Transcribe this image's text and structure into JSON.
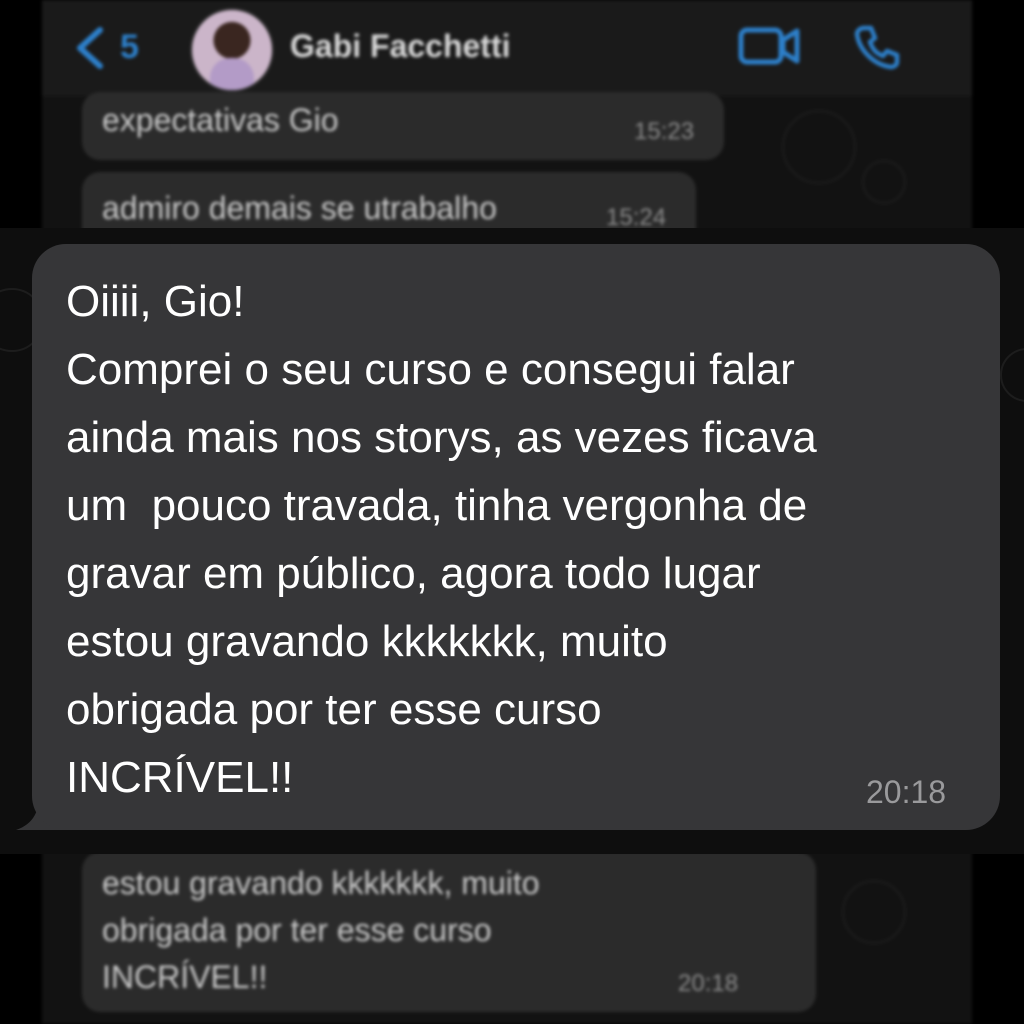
{
  "header": {
    "back_count": "5",
    "contact_name": "Gabi Facchetti",
    "accent_color": "#2d7fc9"
  },
  "background_messages": [
    {
      "text": "expectativas Gio",
      "time": "15:23"
    },
    {
      "text": "admiro demais se utrabalho",
      "time": "15:24"
    },
    {
      "text": "estou gravando kkkkkkk, muito\nobrigada por ter esse curso\nINCRÍVEL!!",
      "time": "20:18"
    }
  ],
  "focused_message": {
    "lines": [
      "Oiiii, Gio!",
      "Comprei o seu curso e consegui falar",
      "ainda mais nos storys, as vezes ficava",
      "um  pouco travada, tinha vergonha de",
      "gravar em público, agora todo lugar",
      "estou gravando kkkkkkk, muito",
      "obrigada por ter esse curso",
      "INCRÍVEL!!"
    ],
    "time": "20:18"
  },
  "icons": [
    "back-chevron-icon",
    "video-call-icon",
    "phone-call-icon"
  ]
}
